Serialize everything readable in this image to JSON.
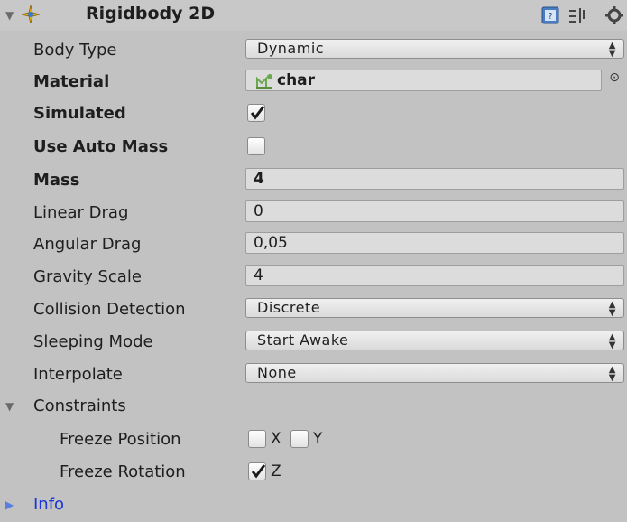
{
  "component": {
    "title": "Rigidbody 2D"
  },
  "fields": {
    "body_type": {
      "label": "Body Type",
      "value": "Dynamic"
    },
    "material": {
      "label": "Material",
      "value": "char"
    },
    "simulated": {
      "label": "Simulated",
      "checked": true
    },
    "use_auto_mass": {
      "label": "Use Auto Mass",
      "checked": false
    },
    "mass": {
      "label": "Mass",
      "value": "4"
    },
    "linear_drag": {
      "label": "Linear Drag",
      "value": "0"
    },
    "angular_drag": {
      "label": "Angular Drag",
      "value": "0,05"
    },
    "gravity_scale": {
      "label": "Gravity Scale",
      "value": "4"
    },
    "collision_detection": {
      "label": "Collision Detection",
      "value": "Discrete"
    },
    "sleeping_mode": {
      "label": "Sleeping Mode",
      "value": "Start Awake"
    },
    "interpolate": {
      "label": "Interpolate",
      "value": "None"
    }
  },
  "constraints": {
    "label": "Constraints",
    "freeze_position": {
      "label": "Freeze Position",
      "x_label": "X",
      "y_label": "Y",
      "x_checked": false,
      "y_checked": false
    },
    "freeze_rotation": {
      "label": "Freeze Rotation",
      "z_label": "Z",
      "z_checked": true
    }
  },
  "info": {
    "label": "Info"
  },
  "colors": {
    "panel_bg": "#c2c2c2",
    "field_bg": "#dcdcdc",
    "info_link": "#1a34d8"
  },
  "icons": {
    "component": "rigidbody2d-icon",
    "help": "help-icon",
    "presets": "presets-icon",
    "settings": "gear-icon",
    "material": "physics-material-icon",
    "object_picker": "object-picker-icon"
  }
}
